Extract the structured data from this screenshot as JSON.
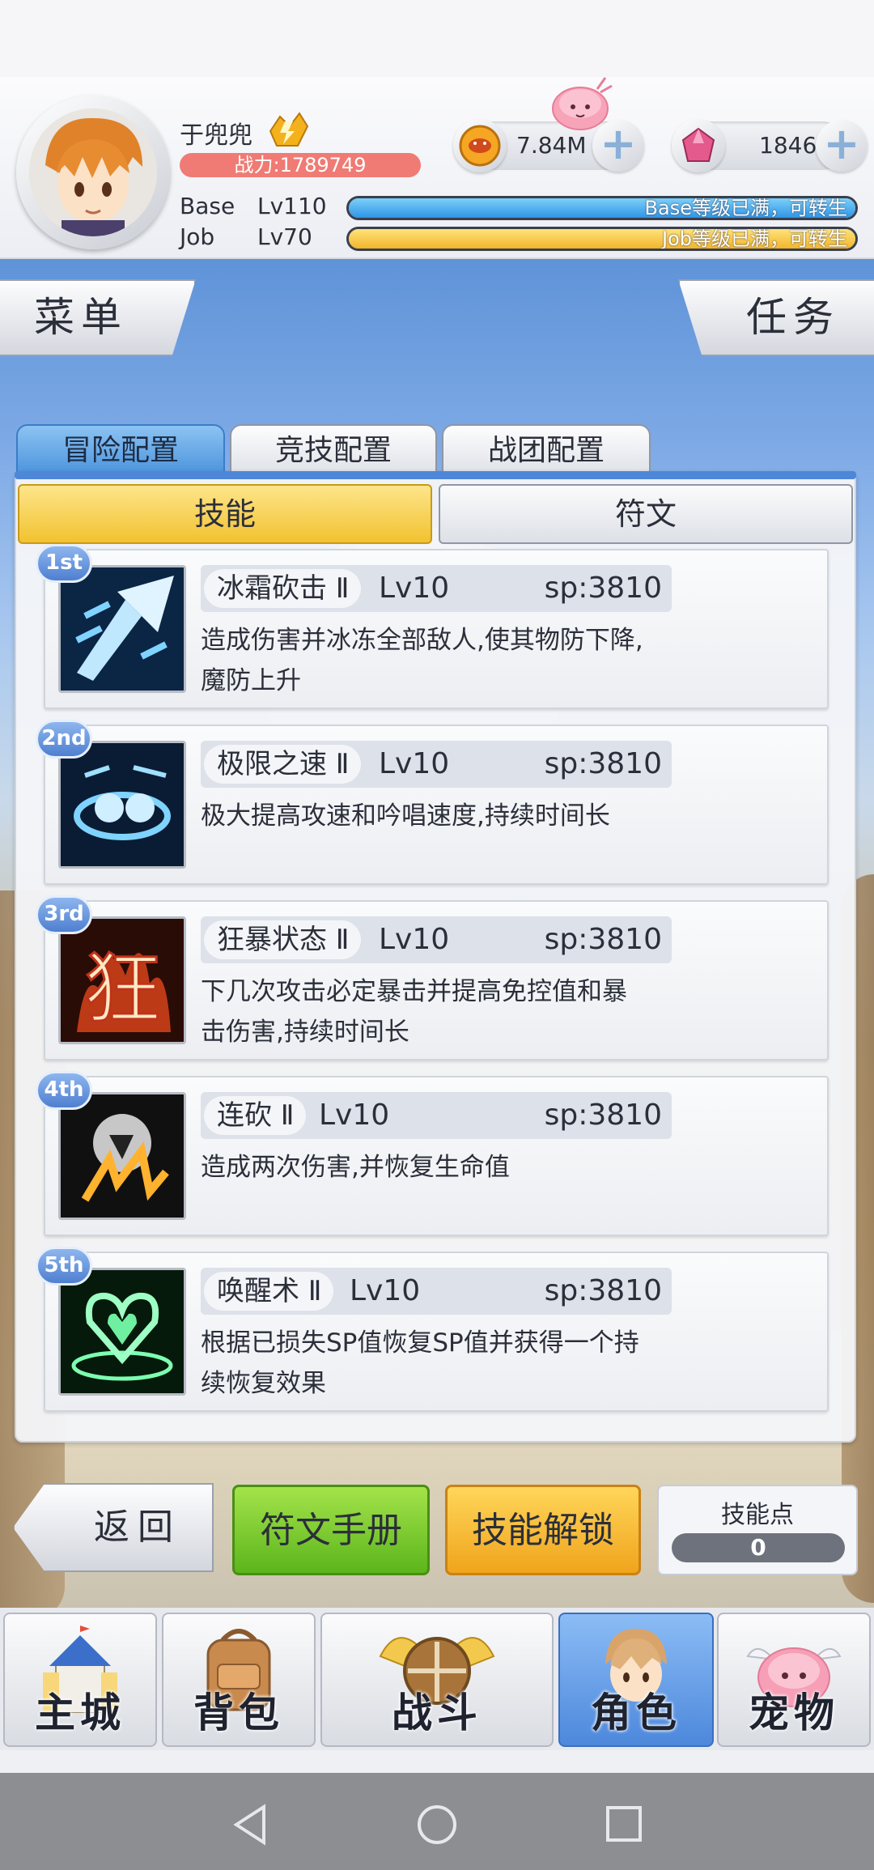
{
  "colors": {
    "accent_blue": "#4e95de",
    "power_red": "#ef7b74",
    "base_bar": "#36a4f0",
    "job_bar": "#f7c540",
    "green_button": "#6cc423",
    "orange_button": "#f4b52a"
  },
  "player": {
    "name": "于兜兜",
    "power": "战力:1789749",
    "base_label": "Base",
    "base_level": "Lv110",
    "base_progress": 1.0,
    "base_status": "Base等级已满，可转生",
    "job_label": "Job",
    "job_level": "Lv70",
    "job_progress": 1.0,
    "job_status": "Job等级已满，可转生"
  },
  "currency": {
    "gold": "7.84M",
    "gems": "1846"
  },
  "side_buttons": {
    "menu": "菜单",
    "tasks": "任务"
  },
  "tabs": [
    "冒险配置",
    "竞技配置",
    "战团配置"
  ],
  "subtabs": [
    "技能",
    "符文"
  ],
  "skills": [
    {
      "rank": "1st",
      "name": "冰霜砍击 Ⅱ",
      "level": "Lv10",
      "sp": "sp:3810",
      "desc_line1": "造成伤害并冰冻全部敌人,使其物防下降,",
      "desc_line2": "魔防上升",
      "icon": "frost-slash-icon"
    },
    {
      "rank": "2nd",
      "name": "极限之速 Ⅱ",
      "level": "Lv10",
      "sp": "sp:3810",
      "desc_line1": "极大提高攻速和吟唱速度,持续时间长",
      "desc_line2": "",
      "icon": "extreme-speed-icon"
    },
    {
      "rank": "3rd",
      "name": "狂暴状态 Ⅱ",
      "level": "Lv10",
      "sp": "sp:3810",
      "desc_line1": "下几次攻击必定暴击并提高免控值和暴",
      "desc_line2": "击伤害,持续时间长",
      "icon": "berserk-icon",
      "icon_glyph": "狂"
    },
    {
      "rank": "4th",
      "name": "连砍 Ⅱ",
      "level": "Lv10",
      "sp": "sp:3810",
      "desc_line1": "造成两次伤害,并恢复生命值",
      "desc_line2": "",
      "icon": "double-slash-icon"
    },
    {
      "rank": "5th",
      "name": "唤醒术 Ⅱ",
      "level": "Lv10",
      "sp": "sp:3810",
      "desc_line1": "根据已损失SP值恢复SP值并获得一个持",
      "desc_line2": "续恢复效果",
      "icon": "awaken-heart-icon"
    }
  ],
  "actions": {
    "back": "返回",
    "rune_manual": "符文手册",
    "skill_unlock": "技能解锁",
    "skill_points_label": "技能点",
    "skill_points_value": "0"
  },
  "nav": [
    {
      "label": "主城",
      "icon": "castle-icon"
    },
    {
      "label": "背包",
      "icon": "backpack-icon"
    },
    {
      "label": "战斗",
      "icon": "battle-shield-icon"
    },
    {
      "label": "角色",
      "icon": "character-icon"
    },
    {
      "label": "宠物",
      "icon": "pet-poring-icon"
    }
  ]
}
